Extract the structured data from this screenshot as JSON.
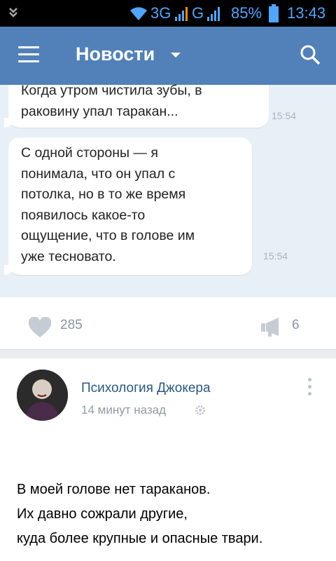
{
  "status_bar": {
    "network1": "3G",
    "network2": "G",
    "battery": "85%",
    "time": "13:43"
  },
  "header": {
    "title": "Новости",
    "menu_icon": "hamburger-icon",
    "dropdown_icon": "caret-down-icon",
    "search_icon": "search-icon"
  },
  "chat_preview": {
    "messages": [
      {
        "lines": [
          "Когда утром чистила зубы, в",
          "раковину упал таракан..."
        ],
        "time": "15:54"
      },
      {
        "lines": [
          "С одной стороны — я",
          "понимала, что он упал с",
          "потолка, но в то же время",
          "появилось какое-то",
          "ощущение, что в голове им",
          "уже тесновато."
        ],
        "time": "15:54"
      }
    ]
  },
  "actions": {
    "likes": "285",
    "shares": "6",
    "like_icon": "heart-icon",
    "share_icon": "megaphone-icon"
  },
  "post": {
    "author": "Психология Джокера",
    "time": "14 минут назад",
    "time_icon": "gear-icon",
    "more_icon": "more-vertical-icon",
    "lines": [
      "В моей голове нет тараканов.",
      "Их давно сожрали другие,",
      "куда более крупные и опасные твари."
    ]
  },
  "colors": {
    "accent": "#5181b8",
    "link": "#2a5885",
    "chat_bg": "#e8f0f7"
  }
}
